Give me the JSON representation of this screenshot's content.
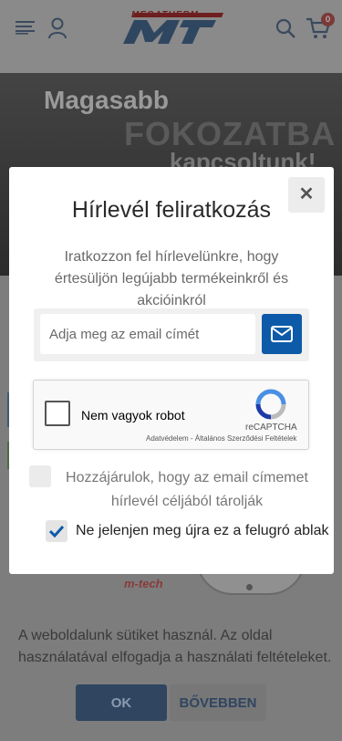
{
  "header": {
    "logo_text": "MEGATHERM",
    "cart_count": "0"
  },
  "hero": {
    "line1": "Magasabb",
    "line2": "FOKOZATBA",
    "line3": "kapcsoltunk!"
  },
  "background": {
    "mtech_text": "m-tech"
  },
  "modal": {
    "close_label": "✕",
    "title": "Hírlevél feliratkozás",
    "description": "Iratkozzon fel hírlevelünkre, hogy értesüljön legújabb termékeinkről és akcióinkról",
    "email_placeholder": "Adja meg az email címét",
    "recaptcha": {
      "label": "Nem vagyok robot",
      "brand": "reCAPTCHA",
      "terms": "Adatvédelem - Általános Szerződési Feltételek"
    },
    "consent_label": "Hozzájárulok, hogy az email címemet hírlevél céljából tárolják",
    "consent_checked": false,
    "no_more_label": "Ne jelenjen meg újra ez a felugró ablak",
    "no_more_checked": true,
    "accent_color": "#0d5ba8"
  },
  "cookie": {
    "text": "A weboldalunk sütiket használ. Az oldal használatával elfogadja a használati feltételeket.",
    "ok_label": "OK",
    "more_label": "BŐVEBBEN"
  }
}
